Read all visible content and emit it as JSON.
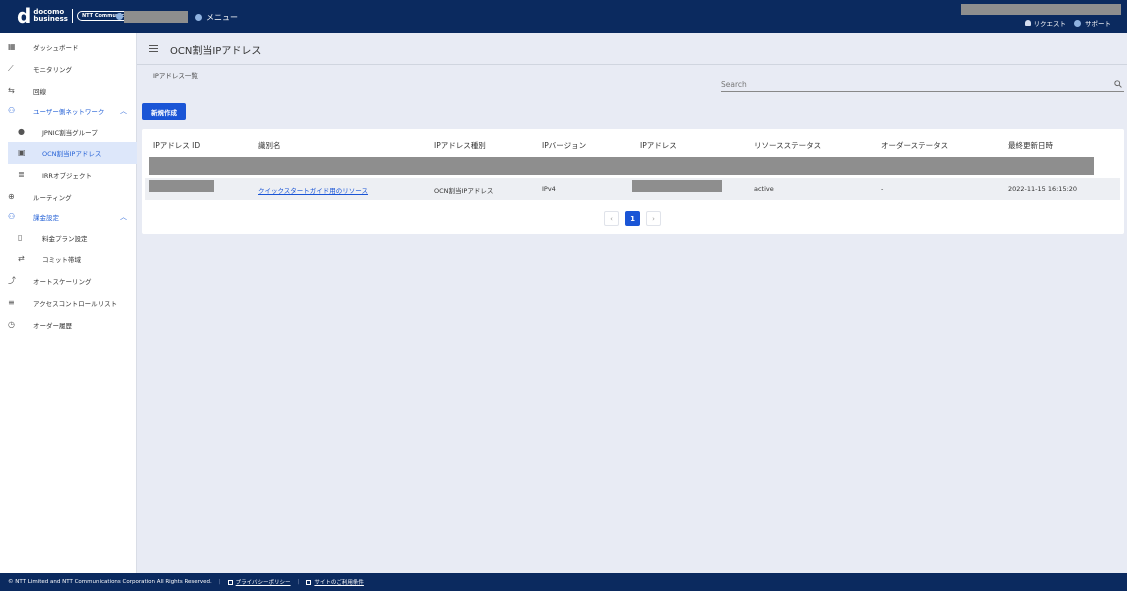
{
  "header": {
    "logo": {
      "mark": "d",
      "line1": "docomo",
      "line2": "business",
      "partner": "NTT Communications"
    },
    "menu_label": "メニュー",
    "request_label": "リクエスト",
    "support_label": "サポート"
  },
  "sidebar": {
    "items": [
      {
        "label": "ダッシュボード"
      },
      {
        "label": "モニタリング"
      },
      {
        "label": "回線"
      },
      {
        "label": "ユーザー側ネットワーク"
      },
      {
        "label": "JPNIC割当グループ"
      },
      {
        "label": "OCN割当IPアドレス"
      },
      {
        "label": "IRRオブジェクト"
      },
      {
        "label": "ルーティング"
      },
      {
        "label": "課金設定"
      },
      {
        "label": "料金プラン設定"
      },
      {
        "label": "コミット帯域"
      },
      {
        "label": "オートスケーリング"
      },
      {
        "label": "アクセスコントロールリスト"
      },
      {
        "label": "オーダー履歴"
      }
    ]
  },
  "page": {
    "title": "OCN割当IPアドレス",
    "subtitle": "IPアドレス一覧",
    "search_placeholder": "Search",
    "new_button": "新規作成"
  },
  "table": {
    "headers": [
      "IPアドレス ID",
      "識別名",
      "IPアドレス種別",
      "IPバージョン",
      "IPアドレス",
      "リソースステータス",
      "オーダーステータス",
      "最終更新日時"
    ],
    "rows": [
      {
        "name": "クイックスタートガイド用のリソース",
        "type": "OCN割当IPアドレス",
        "version": "IPv4",
        "resource_status": "active",
        "order_status": "-",
        "updated": "2022-11-15 16:15:20"
      }
    ]
  },
  "pagination": {
    "prev": "‹",
    "current": "1",
    "next": "›"
  },
  "footer": {
    "copyright": "© NTT Limited and NTT Communications Corporation All Rights Reserved.",
    "privacy": "プライバシーポリシー",
    "terms": "サイトのご利用条件"
  },
  "colors": {
    "header_bg": "#0b2a5f",
    "accent": "#1a55d6",
    "page_bg": "#e8ebf4"
  }
}
